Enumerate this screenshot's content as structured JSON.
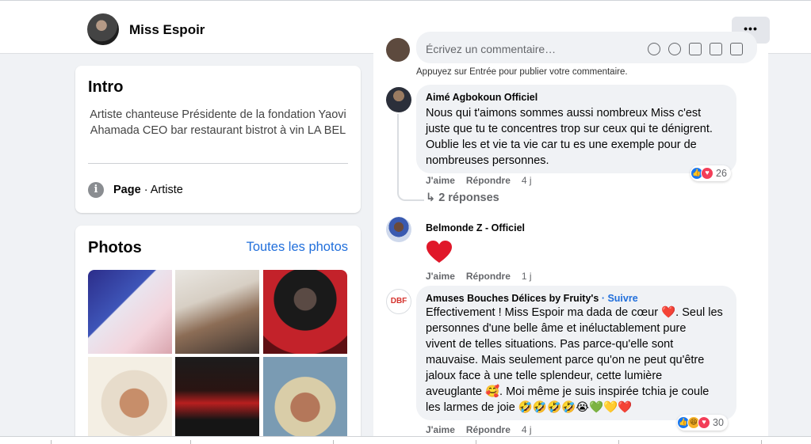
{
  "header": {
    "page_name": "Miss Espoir",
    "more_label": "•••"
  },
  "intro": {
    "title": "Intro",
    "bio": "Artiste chanteuse Présidente de la fondation Yaovi Ahamada CEO bar restaurant bistrot à vin LA BEL",
    "category_bold": "Page",
    "category_rest": " · Artiste"
  },
  "photos": {
    "title": "Photos",
    "see_all": "Toutes les photos"
  },
  "composer": {
    "placeholder": "Écrivez un commentaire…",
    "hint": "Appuyez sur Entrée pour publier votre commentaire."
  },
  "comments": [
    {
      "author": "Aimé Agbokoun Officiel",
      "lines": [
        "Nous qui t'aimons sommes aussi nombreux Miss c'est",
        "juste que tu te concentres trop sur ceux qui te dénigrent.",
        "Oublie les et vie ta vie car tu es une exemple pour de",
        "nombreuses personnes."
      ],
      "like": "J'aime",
      "reply": "Répondre",
      "time": "4 j",
      "reactions": "26",
      "replies_label": "2 réponses"
    },
    {
      "author": "Belmonde Z - Officiel",
      "text": "❤️",
      "like": "J'aime",
      "reply": "Répondre",
      "time": "1 j"
    },
    {
      "author": "Amuses Bouches Délices by Fruity's",
      "separator": " · ",
      "follow": "Suivre",
      "lines": [
        "Effectivement ! Miss Espoir ma dada de cœur ❤️. Seul les",
        "personnes d'une belle âme et inéluctablement pure",
        "vivent de telles situations. Pas parce-qu'elle sont",
        "mauvaise. Mais seulement parce qu'on ne peut qu'être",
        "jaloux face à une telle splendeur, cette lumière",
        "aveuglante 🥰. Moi même je suis inspirée tchia je coule",
        "les larmes de joie 🤣🤣🤣🤣😭💚💛❤️"
      ],
      "like": "J'aime",
      "reply": "Répondre",
      "time": "4 j",
      "reactions": "30"
    }
  ],
  "colors": {
    "link": "#216fdb",
    "like": "#1877f2",
    "love": "#f33e58",
    "bubble": "#f0f2f5"
  }
}
